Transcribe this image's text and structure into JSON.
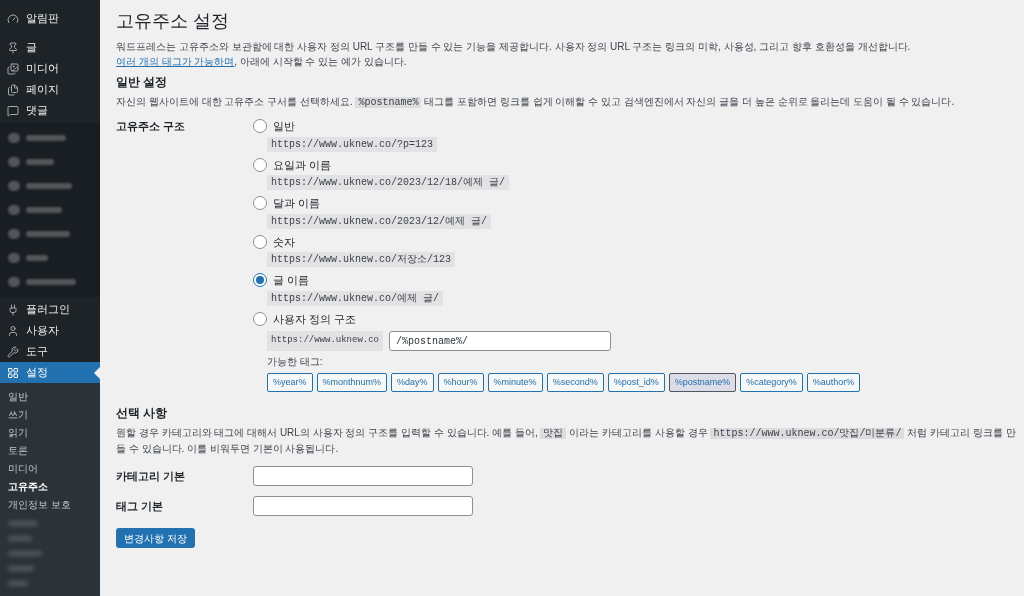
{
  "sidebar": {
    "items": [
      {
        "label": "알림판",
        "selected": false
      },
      {
        "kind": "gap"
      },
      {
        "label": "글",
        "selected": false
      },
      {
        "label": "미디어",
        "selected": false
      },
      {
        "label": "페이지",
        "selected": false
      },
      {
        "label": "댓글",
        "selected": false
      },
      {
        "kind": "blurred"
      },
      {
        "label": "플러그인",
        "selected": false
      },
      {
        "label": "사용자",
        "selected": false
      },
      {
        "label": "도구",
        "selected": false
      },
      {
        "label": "설정",
        "selected": true
      }
    ],
    "submenu": [
      {
        "label": "일반",
        "selected": false
      },
      {
        "label": "쓰기",
        "selected": false
      },
      {
        "label": "읽기",
        "selected": false
      },
      {
        "label": "토론",
        "selected": false
      },
      {
        "label": "미디어",
        "selected": false
      },
      {
        "label": "고유주소",
        "selected": true
      },
      {
        "label": "개인정보 보호",
        "selected": false
      }
    ]
  },
  "page": {
    "title": "고유주소 설정",
    "intro": [
      {
        "kind": "text",
        "text": "워드프레스는 고유주소와 보관함에 대한 사용자 정의 URL 구조를 만들 수 있는 기능을 제공합니다. 사용자 정의 URL 구조는 링크의 미학, 사용성, 그리고 향후 호환성을 개선합니다. "
      },
      {
        "kind": "link",
        "text": "여러 개의 태그가 가능하며"
      },
      {
        "kind": "text",
        "text": ", 아래에 시작할 수 있는 예가 있습니다."
      }
    ],
    "general": {
      "heading": "일반 설정",
      "description": [
        {
          "kind": "text",
          "text": "자신의 웹사이트에 대한 고유주소 구서를 선택하세요. "
        },
        {
          "kind": "code",
          "text": "%postname%"
        },
        {
          "kind": "text",
          "text": " 태그를 포함하면 링크를 쉽게 이해할 수 있고 검색엔진에서 자신의 글을 더 높은 순위로 올리는데 도움이 될 수 있습니다."
        }
      ],
      "label": "고유주소 구조",
      "options": [
        {
          "label": "일반",
          "example": "https://www.uknew.co/?p=123",
          "selected": false
        },
        {
          "label": "요일과 이름",
          "example": "https://www.uknew.co/2023/12/18/예제 글/",
          "selected": false
        },
        {
          "label": "달과 이름",
          "example": "https://www.uknew.co/2023/12/예제 글/",
          "selected": false
        },
        {
          "label": "숫자",
          "example": "https://www.uknew.co/저장소/123",
          "selected": false
        },
        {
          "label": "글 이름",
          "example": "https://www.uknew.co/예제 글/",
          "selected": true
        }
      ],
      "custom": {
        "label": "사용자 정의 구조",
        "selected": false,
        "prefix": "https://www.uknew.co",
        "value": "/%postname%/",
        "tags_label": "가능한 태그:",
        "tags": [
          {
            "label": "%year%",
            "selected": false
          },
          {
            "label": "%monthnum%",
            "selected": false
          },
          {
            "label": "%day%",
            "selected": false
          },
          {
            "label": "%hour%",
            "selected": false
          },
          {
            "label": "%minute%",
            "selected": false
          },
          {
            "label": "%second%",
            "selected": false
          },
          {
            "label": "%post_id%",
            "selected": false
          },
          {
            "label": "%postname%",
            "selected": true
          },
          {
            "label": "%category%",
            "selected": false
          },
          {
            "label": "%author%",
            "selected": false
          }
        ]
      }
    },
    "optional": {
      "heading": "선택 사항",
      "description": [
        {
          "kind": "text",
          "text": "원할 경우 카테고리와 태그에 대해서 URL의 사용자 정의 구조를 입력할 수 있습니다. 예를 들어, "
        },
        {
          "kind": "code",
          "text": "맛집"
        },
        {
          "kind": "text",
          "text": " 이라는 카테고리를 사용할 경우 "
        },
        {
          "kind": "code",
          "text": "https://www.uknew.co/맛집/미분류/"
        },
        {
          "kind": "text",
          "text": " 처럼 카테고리 링크를 만들 수 있습니다. 이를 비워두면 기본이 사용됩니다."
        }
      ],
      "fields": [
        {
          "label": "카테고리 기본"
        },
        {
          "label": "태그 기본"
        }
      ]
    },
    "save_button": "변경사항 저장"
  }
}
